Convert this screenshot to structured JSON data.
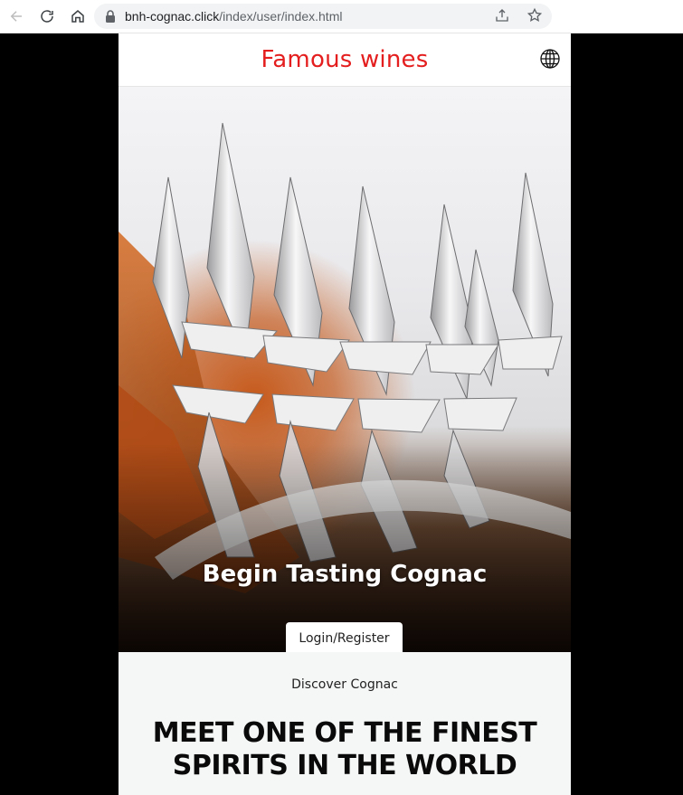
{
  "browser": {
    "url_host": "bnh-cognac.click",
    "url_path": "/index/user/index.html",
    "icons": [
      "back-icon",
      "reload-icon",
      "home-icon",
      "lock-icon",
      "share-icon",
      "star-icon"
    ]
  },
  "header": {
    "brand": "Famous wines",
    "brand_color": "#e41e1e",
    "language_icon": "globe-icon"
  },
  "hero": {
    "title": "Begin Tasting Cognac",
    "login_label": "Login/Register"
  },
  "discover": {
    "kicker": "Discover Cognac",
    "heading": "MEET ONE OF THE FINEST SPIRITS IN THE WORLD"
  }
}
